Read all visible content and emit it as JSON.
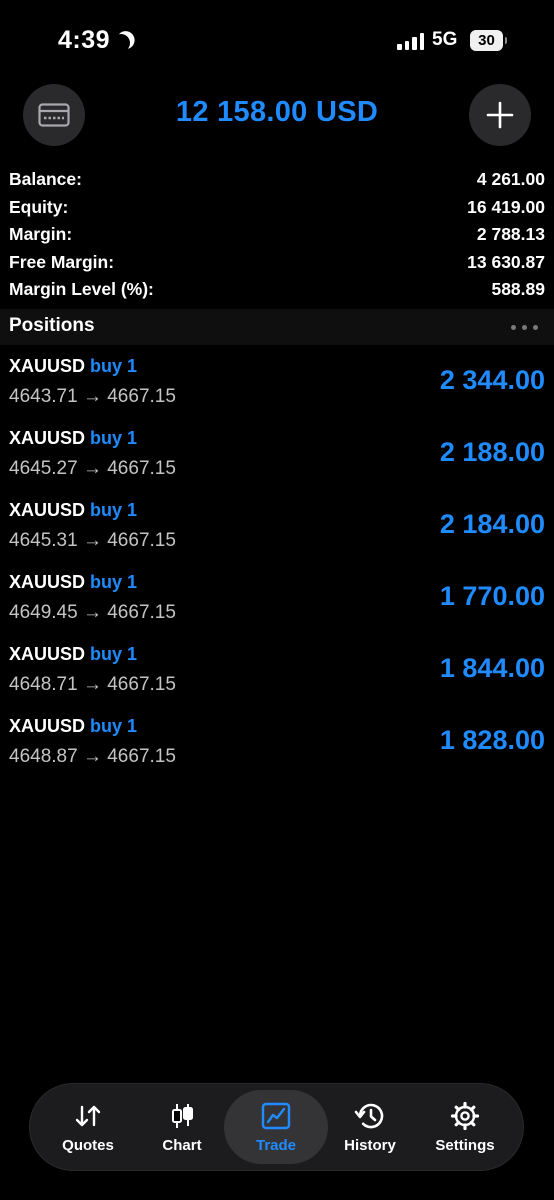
{
  "status_bar": {
    "time": "4:39",
    "network": "5G",
    "battery": "30"
  },
  "header": {
    "title": "12 158.00 USD"
  },
  "account": [
    {
      "label": "Balance:",
      "value": "4 261.00"
    },
    {
      "label": "Equity:",
      "value": "16 419.00"
    },
    {
      "label": "Margin:",
      "value": "2 788.13"
    },
    {
      "label": "Free Margin:",
      "value": "13 630.87"
    },
    {
      "label": "Margin Level (%):",
      "value": "588.89"
    }
  ],
  "positions": {
    "title": "Positions",
    "items": [
      {
        "symbol": "XAUUSD",
        "side": "buy 1",
        "prices": "4643.71 → 4667.15",
        "profit": "2 344.00"
      },
      {
        "symbol": "XAUUSD",
        "side": "buy 1",
        "prices": "4645.27 → 4667.15",
        "profit": "2 188.00"
      },
      {
        "symbol": "XAUUSD",
        "side": "buy 1",
        "prices": "4645.31 → 4667.15",
        "profit": "2 184.00"
      },
      {
        "symbol": "XAUUSD",
        "side": "buy 1",
        "prices": "4649.45 → 4667.15",
        "profit": "1 770.00"
      },
      {
        "symbol": "XAUUSD",
        "side": "buy 1",
        "prices": "4648.71 → 4667.15",
        "profit": "1 844.00"
      },
      {
        "symbol": "XAUUSD",
        "side": "buy 1",
        "prices": "4648.87 → 4667.15",
        "profit": "1 828.00"
      }
    ]
  },
  "tabs": [
    {
      "label": "Quotes",
      "icon": "quotes-arrows-icon"
    },
    {
      "label": "Chart",
      "icon": "candlestick-icon"
    },
    {
      "label": "Trade",
      "icon": "trade-chart-icon",
      "active": true
    },
    {
      "label": "History",
      "icon": "history-clock-icon"
    },
    {
      "label": "Settings",
      "icon": "gear-icon"
    }
  ],
  "colors": {
    "accent": "#1f8bff",
    "background": "#000000",
    "muted_text": "#c4c4c6"
  }
}
